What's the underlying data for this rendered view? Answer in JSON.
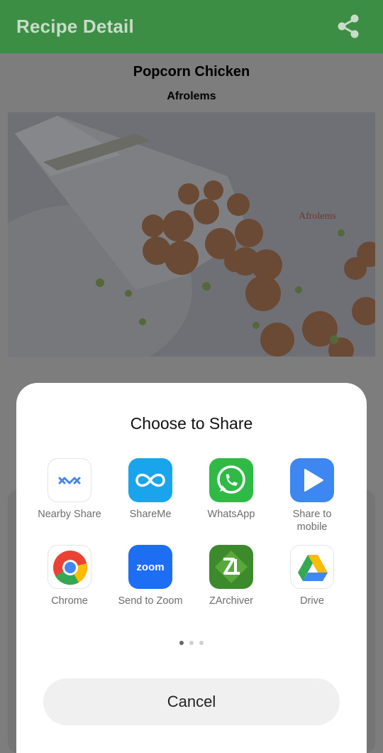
{
  "appbar": {
    "title": "Recipe Detail",
    "share_icon": "share-icon",
    "color": "#3b8e43"
  },
  "recipe": {
    "title": "Popcorn Chicken",
    "author": "Afrolems",
    "image_watermark": "Afrolems"
  },
  "share_sheet": {
    "title": "Choose to Share",
    "apps": [
      {
        "label": "Nearby Share",
        "icon": "nearby-share-icon"
      },
      {
        "label": "ShareMe",
        "icon": "shareme-icon"
      },
      {
        "label": "WhatsApp",
        "icon": "whatsapp-icon"
      },
      {
        "label": "Share to mobile",
        "icon": "share-to-mobile-icon"
      },
      {
        "label": "Chrome",
        "icon": "chrome-icon"
      },
      {
        "label": "Send to Zoom",
        "icon": "zoom-icon"
      },
      {
        "label": "ZArchiver",
        "icon": "zarchiver-icon"
      },
      {
        "label": "Drive",
        "icon": "google-drive-icon"
      }
    ],
    "page_count": 3,
    "active_page": 1,
    "cancel_label": "Cancel"
  }
}
